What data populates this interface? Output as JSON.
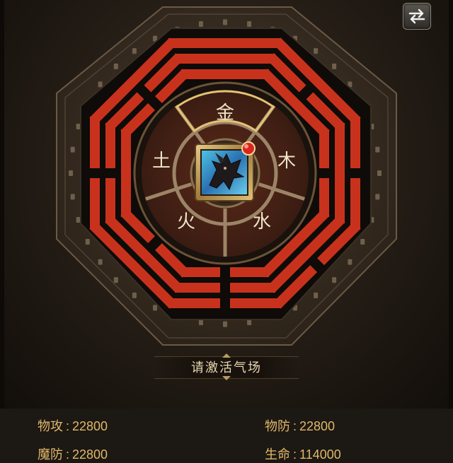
{
  "bagua": {
    "elements": {
      "top": "金",
      "left": "土",
      "right": "木",
      "bottom_left": "火",
      "bottom_right": "水"
    },
    "center_item_icon": "dragon-icon",
    "notification_dot_color": "#d8261c",
    "trigram_color": "#c8321c"
  },
  "swap_button_icon": "swap-arrows-icon",
  "activate_label": "请激活气场",
  "stats": [
    {
      "label": "物攻",
      "value": "22800"
    },
    {
      "label": "物防",
      "value": "22800"
    },
    {
      "label": "魔防",
      "value": "22800"
    },
    {
      "label": "生命",
      "value": "114000"
    }
  ]
}
